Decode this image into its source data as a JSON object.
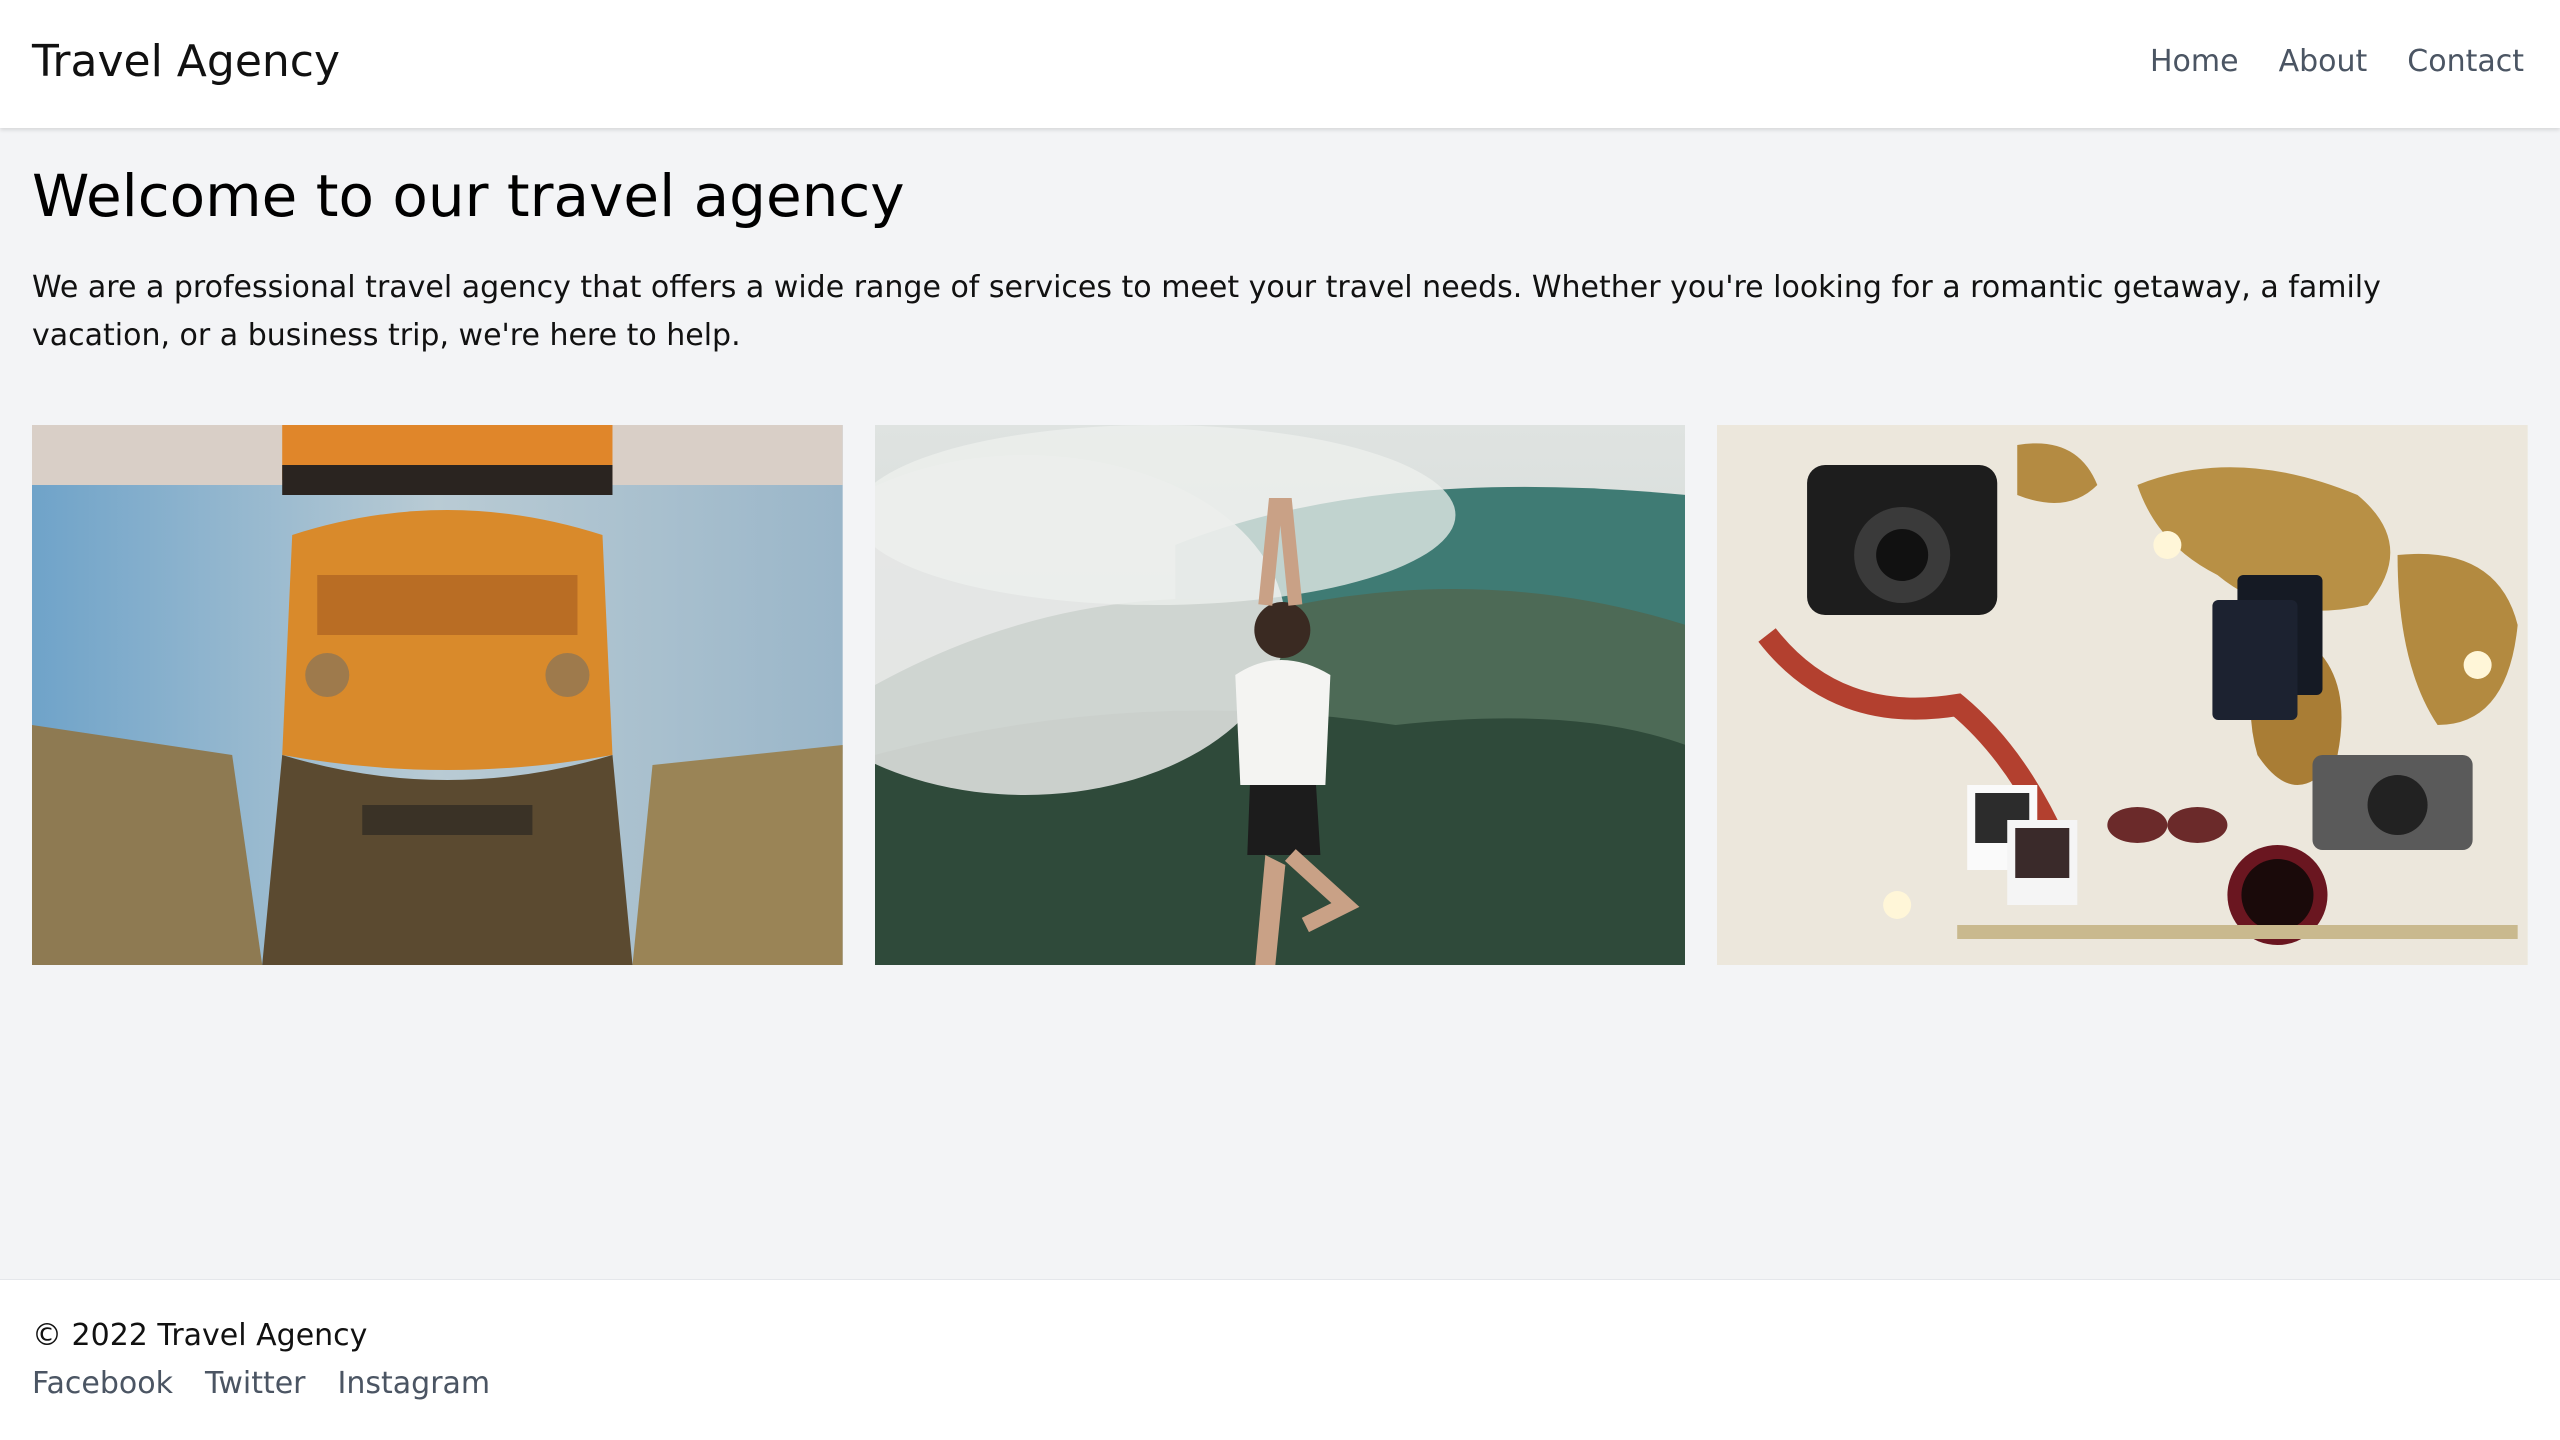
{
  "header": {
    "brand": "Travel Agency",
    "nav": [
      "Home",
      "About",
      "Contact"
    ]
  },
  "main": {
    "title": "Welcome to our travel agency",
    "intro": "We are a professional travel agency that offers a wide range of services to meet your travel needs. Whether you're looking for a romantic getaway, a family vacation, or a business trip, we're here to help."
  },
  "gallery": [
    {
      "subject": "van reflected in a puddle"
    },
    {
      "subject": "person doing yoga on a misty mountain"
    },
    {
      "subject": "travel flat lay with cameras, passports and a world map"
    }
  ],
  "footer": {
    "copyright": "© 2022 Travel Agency",
    "social": [
      "Facebook",
      "Twitter",
      "Instagram"
    ]
  },
  "colors": {
    "page_bg": "#f3f4f6",
    "header_bg": "#ffffff",
    "nav_text": "#4b5563",
    "footer_bg": "#ffffff"
  }
}
